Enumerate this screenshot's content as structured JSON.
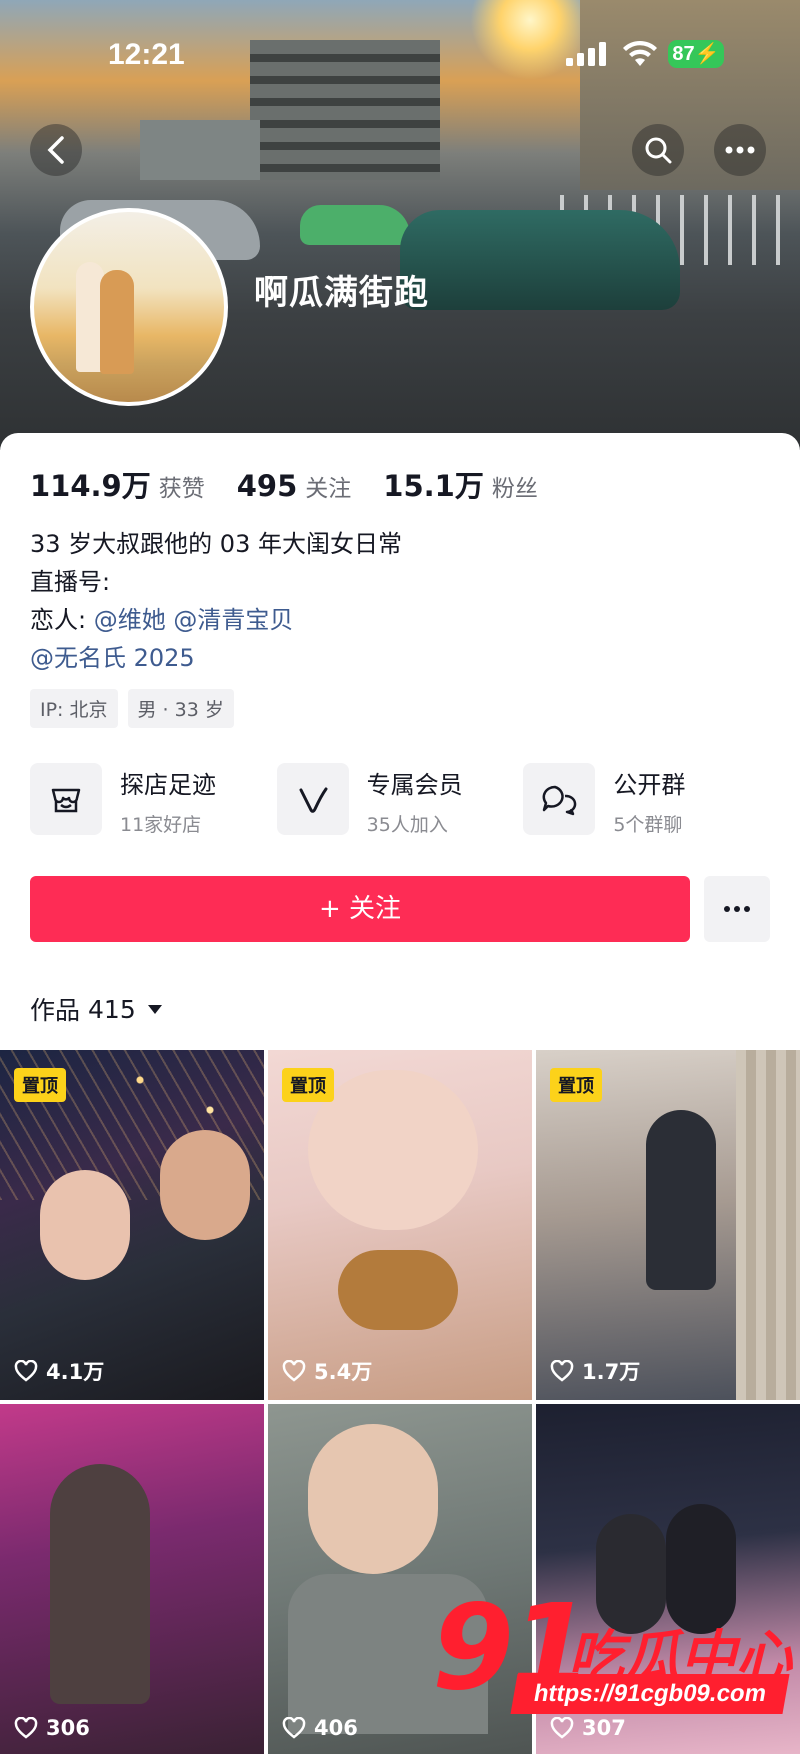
{
  "status_bar": {
    "time": "12:21",
    "battery": "87"
  },
  "profile": {
    "nickname": "啊瓜满街跑",
    "stats": [
      {
        "value": "114.9万",
        "label": "获赞"
      },
      {
        "value": "495",
        "label": "关注"
      },
      {
        "value": "15.1万",
        "label": "粉丝"
      }
    ],
    "bio": {
      "line1": "33 岁大叔跟他的 03 年大闺女日常",
      "line2": "直播号:",
      "line3_prefix": "恋人:",
      "mention1": "@维她",
      "mention2": "@清青宝贝",
      "mention3": "@无名氏 2025"
    },
    "tags": [
      "IP: 北京",
      "男 · 33 岁"
    ]
  },
  "features": [
    {
      "icon": "shop-icon",
      "title": "探店足迹",
      "subtitle": "11家好店"
    },
    {
      "icon": "vip-icon",
      "title": "专属会员",
      "subtitle": "35人加入"
    },
    {
      "icon": "group-chat-icon",
      "title": "公开群",
      "subtitle": "5个群聊"
    }
  ],
  "actions": {
    "follow_label": "+ 关注"
  },
  "works": {
    "label": "作品",
    "count": "415"
  },
  "grid": [
    {
      "pinned": "置顶",
      "likes": "4.1万"
    },
    {
      "pinned": "置顶",
      "likes": "5.4万"
    },
    {
      "pinned": "置顶",
      "likes": "1.7万"
    },
    {
      "pinned": "",
      "likes": "306"
    },
    {
      "pinned": "",
      "likes": "406"
    },
    {
      "pinned": "",
      "likes": "307"
    }
  ],
  "watermark": {
    "big": "91",
    "cn": "吃瓜中心",
    "url": "https://91cgb09.com"
  },
  "colors": {
    "accent": "#fe2c55",
    "mention": "#3e5b8f",
    "pin": "#fcd21a"
  }
}
